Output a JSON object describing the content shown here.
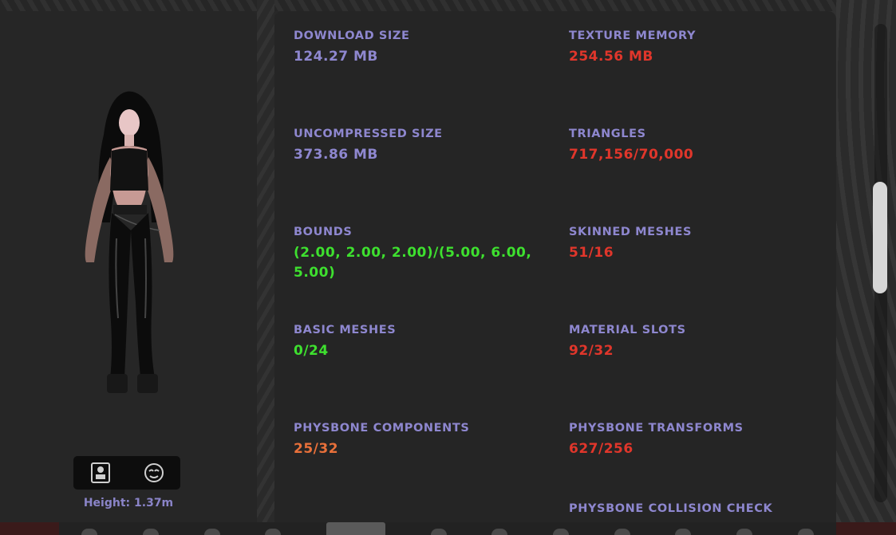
{
  "avatar": {
    "height_label": "Height:",
    "height_value": "1.37m"
  },
  "stats": [
    {
      "label": "DOWNLOAD SIZE",
      "value": "124.27 MB",
      "color": "#8e87cf"
    },
    {
      "label": "TEXTURE MEMORY",
      "value": "254.56 MB",
      "color": "#e0362b"
    },
    {
      "label": "UNCOMPRESSED SIZE",
      "value": "373.86 MB",
      "color": "#8e87cf"
    },
    {
      "label": "TRIANGLES",
      "value": "717,156/70,000",
      "color": "#e0362b"
    },
    {
      "label": "BOUNDS",
      "value": "(2.00, 2.00, 2.00)/(5.00, 6.00, 5.00)",
      "color": "#3ee02f"
    },
    {
      "label": "SKINNED MESHES",
      "value": "51/16",
      "color": "#e0362b"
    },
    {
      "label": "BASIC MESHES",
      "value": "0/24",
      "color": "#3ee02f"
    },
    {
      "label": "MATERIAL SLOTS",
      "value": "92/32",
      "color": "#e0362b"
    },
    {
      "label": "PHYSBONE COMPONENTS",
      "value": "25/32",
      "color": "#e8703a"
    },
    {
      "label": "PHYSBONE TRANSFORMS",
      "value": "627/256",
      "color": "#e0362b"
    },
    {
      "label": "PHYSBONE COLLISION CHECK",
      "value": "",
      "color": "#e0362b"
    }
  ],
  "icons": {
    "toolbar": [
      "id-card-icon",
      "face-mask-icon"
    ]
  }
}
